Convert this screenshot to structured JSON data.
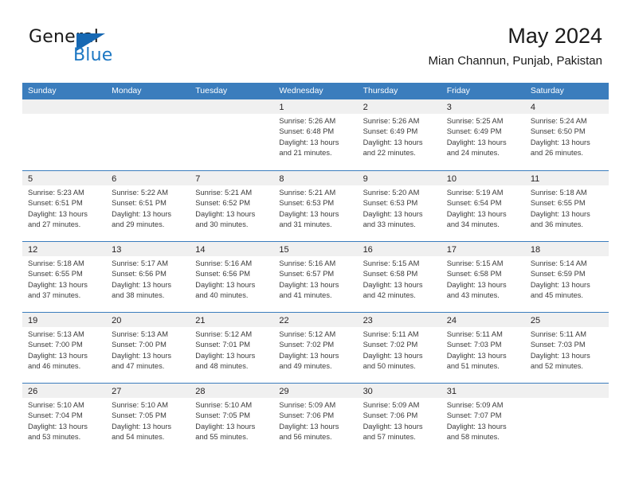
{
  "brand": {
    "name_top": "General",
    "name_bottom": "Blue",
    "accent_color": "#1668b3",
    "text_color": "#1a1a1a"
  },
  "header": {
    "title": "May 2024",
    "subtitle": "Mian Channun, Punjab, Pakistan"
  },
  "theme": {
    "header_row_bg": "#3b7dbd",
    "day_band_bg": "#f0f0f0",
    "grid_line": "#3b7dbd",
    "body_text": "#3b3b3b"
  },
  "weekdays": [
    "Sunday",
    "Monday",
    "Tuesday",
    "Wednesday",
    "Thursday",
    "Friday",
    "Saturday"
  ],
  "weeks": [
    [
      {
        "day": "",
        "lines": []
      },
      {
        "day": "",
        "lines": []
      },
      {
        "day": "",
        "lines": []
      },
      {
        "day": "1",
        "lines": [
          "Sunrise: 5:26 AM",
          "Sunset: 6:48 PM",
          "Daylight: 13 hours",
          "and 21 minutes."
        ]
      },
      {
        "day": "2",
        "lines": [
          "Sunrise: 5:26 AM",
          "Sunset: 6:49 PM",
          "Daylight: 13 hours",
          "and 22 minutes."
        ]
      },
      {
        "day": "3",
        "lines": [
          "Sunrise: 5:25 AM",
          "Sunset: 6:49 PM",
          "Daylight: 13 hours",
          "and 24 minutes."
        ]
      },
      {
        "day": "4",
        "lines": [
          "Sunrise: 5:24 AM",
          "Sunset: 6:50 PM",
          "Daylight: 13 hours",
          "and 26 minutes."
        ]
      }
    ],
    [
      {
        "day": "5",
        "lines": [
          "Sunrise: 5:23 AM",
          "Sunset: 6:51 PM",
          "Daylight: 13 hours",
          "and 27 minutes."
        ]
      },
      {
        "day": "6",
        "lines": [
          "Sunrise: 5:22 AM",
          "Sunset: 6:51 PM",
          "Daylight: 13 hours",
          "and 29 minutes."
        ]
      },
      {
        "day": "7",
        "lines": [
          "Sunrise: 5:21 AM",
          "Sunset: 6:52 PM",
          "Daylight: 13 hours",
          "and 30 minutes."
        ]
      },
      {
        "day": "8",
        "lines": [
          "Sunrise: 5:21 AM",
          "Sunset: 6:53 PM",
          "Daylight: 13 hours",
          "and 31 minutes."
        ]
      },
      {
        "day": "9",
        "lines": [
          "Sunrise: 5:20 AM",
          "Sunset: 6:53 PM",
          "Daylight: 13 hours",
          "and 33 minutes."
        ]
      },
      {
        "day": "10",
        "lines": [
          "Sunrise: 5:19 AM",
          "Sunset: 6:54 PM",
          "Daylight: 13 hours",
          "and 34 minutes."
        ]
      },
      {
        "day": "11",
        "lines": [
          "Sunrise: 5:18 AM",
          "Sunset: 6:55 PM",
          "Daylight: 13 hours",
          "and 36 minutes."
        ]
      }
    ],
    [
      {
        "day": "12",
        "lines": [
          "Sunrise: 5:18 AM",
          "Sunset: 6:55 PM",
          "Daylight: 13 hours",
          "and 37 minutes."
        ]
      },
      {
        "day": "13",
        "lines": [
          "Sunrise: 5:17 AM",
          "Sunset: 6:56 PM",
          "Daylight: 13 hours",
          "and 38 minutes."
        ]
      },
      {
        "day": "14",
        "lines": [
          "Sunrise: 5:16 AM",
          "Sunset: 6:56 PM",
          "Daylight: 13 hours",
          "and 40 minutes."
        ]
      },
      {
        "day": "15",
        "lines": [
          "Sunrise: 5:16 AM",
          "Sunset: 6:57 PM",
          "Daylight: 13 hours",
          "and 41 minutes."
        ]
      },
      {
        "day": "16",
        "lines": [
          "Sunrise: 5:15 AM",
          "Sunset: 6:58 PM",
          "Daylight: 13 hours",
          "and 42 minutes."
        ]
      },
      {
        "day": "17",
        "lines": [
          "Sunrise: 5:15 AM",
          "Sunset: 6:58 PM",
          "Daylight: 13 hours",
          "and 43 minutes."
        ]
      },
      {
        "day": "18",
        "lines": [
          "Sunrise: 5:14 AM",
          "Sunset: 6:59 PM",
          "Daylight: 13 hours",
          "and 45 minutes."
        ]
      }
    ],
    [
      {
        "day": "19",
        "lines": [
          "Sunrise: 5:13 AM",
          "Sunset: 7:00 PM",
          "Daylight: 13 hours",
          "and 46 minutes."
        ]
      },
      {
        "day": "20",
        "lines": [
          "Sunrise: 5:13 AM",
          "Sunset: 7:00 PM",
          "Daylight: 13 hours",
          "and 47 minutes."
        ]
      },
      {
        "day": "21",
        "lines": [
          "Sunrise: 5:12 AM",
          "Sunset: 7:01 PM",
          "Daylight: 13 hours",
          "and 48 minutes."
        ]
      },
      {
        "day": "22",
        "lines": [
          "Sunrise: 5:12 AM",
          "Sunset: 7:02 PM",
          "Daylight: 13 hours",
          "and 49 minutes."
        ]
      },
      {
        "day": "23",
        "lines": [
          "Sunrise: 5:11 AM",
          "Sunset: 7:02 PM",
          "Daylight: 13 hours",
          "and 50 minutes."
        ]
      },
      {
        "day": "24",
        "lines": [
          "Sunrise: 5:11 AM",
          "Sunset: 7:03 PM",
          "Daylight: 13 hours",
          "and 51 minutes."
        ]
      },
      {
        "day": "25",
        "lines": [
          "Sunrise: 5:11 AM",
          "Sunset: 7:03 PM",
          "Daylight: 13 hours",
          "and 52 minutes."
        ]
      }
    ],
    [
      {
        "day": "26",
        "lines": [
          "Sunrise: 5:10 AM",
          "Sunset: 7:04 PM",
          "Daylight: 13 hours",
          "and 53 minutes."
        ]
      },
      {
        "day": "27",
        "lines": [
          "Sunrise: 5:10 AM",
          "Sunset: 7:05 PM",
          "Daylight: 13 hours",
          "and 54 minutes."
        ]
      },
      {
        "day": "28",
        "lines": [
          "Sunrise: 5:10 AM",
          "Sunset: 7:05 PM",
          "Daylight: 13 hours",
          "and 55 minutes."
        ]
      },
      {
        "day": "29",
        "lines": [
          "Sunrise: 5:09 AM",
          "Sunset: 7:06 PM",
          "Daylight: 13 hours",
          "and 56 minutes."
        ]
      },
      {
        "day": "30",
        "lines": [
          "Sunrise: 5:09 AM",
          "Sunset: 7:06 PM",
          "Daylight: 13 hours",
          "and 57 minutes."
        ]
      },
      {
        "day": "31",
        "lines": [
          "Sunrise: 5:09 AM",
          "Sunset: 7:07 PM",
          "Daylight: 13 hours",
          "and 58 minutes."
        ]
      },
      {
        "day": "",
        "lines": []
      }
    ]
  ]
}
